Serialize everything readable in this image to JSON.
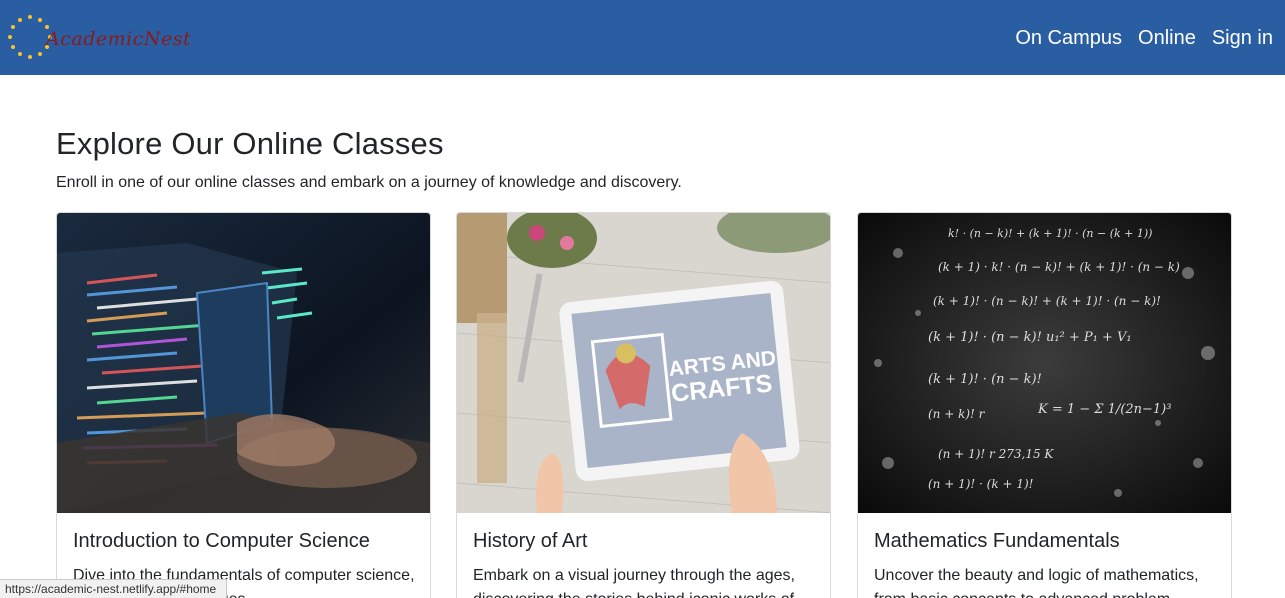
{
  "navbar": {
    "brand": "AcademicNest",
    "brand_icon": "star-ring-logo",
    "links": [
      "On Campus",
      "Online",
      "Sign in"
    ],
    "bg_color": "#2a5ea3"
  },
  "main": {
    "title": "Explore Our Online Classes",
    "subtitle": "Enroll in one of our online classes and embark on a journey of knowledge and discovery."
  },
  "cards": [
    {
      "title": "Introduction to Computer Science",
      "text": "Dive into the fundamentals of computer science, programming languages",
      "image": "laptop-code-photo"
    },
    {
      "title": "History of Art",
      "text": "Embark on a visual journey through the ages, discovering the stories behind iconic works of",
      "image": "arts-and-crafts-tablet-photo",
      "image_text": "ARTS AND CRAFTS"
    },
    {
      "title": "Mathematics Fundamentals",
      "text": "Uncover the beauty and logic of mathematics, from basic concepts to advanced problem-",
      "image": "math-formulas-photo",
      "image_text": "K = 1 − Σ 1/(2n−1)"
    }
  ],
  "status_bar": {
    "url": "https://academic-nest.netlify.app/#home"
  }
}
